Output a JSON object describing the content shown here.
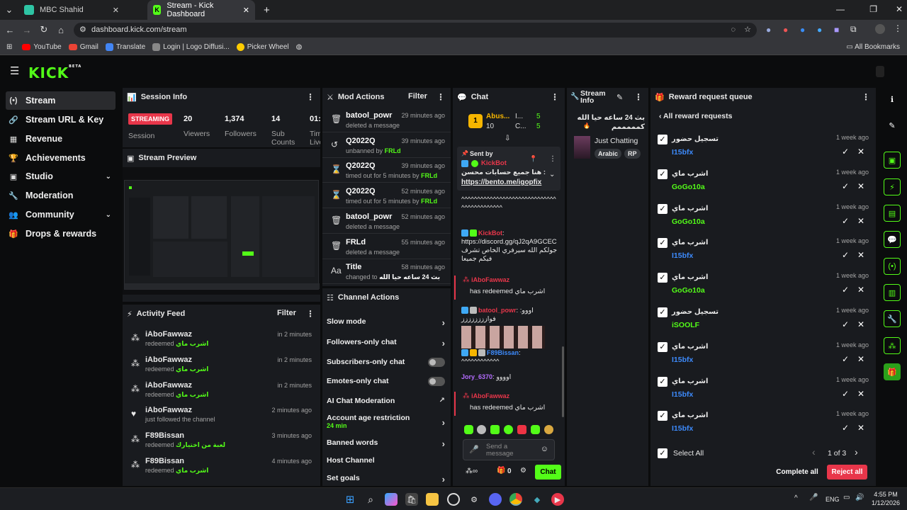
{
  "browser": {
    "tabs": [
      {
        "title": "MBC Shahid"
      },
      {
        "title": "Stream - Kick Dashboard"
      }
    ],
    "url": "dashboard.kick.com/stream",
    "bookmarks": [
      "YouTube",
      "Gmail",
      "Translate",
      "Login | Logo Diffusi...",
      "Picker Wheel"
    ],
    "all_bookmarks": "All Bookmarks"
  },
  "logo": {
    "text": "KICK",
    "tag": "BETA"
  },
  "sidebar": {
    "items": [
      {
        "label": "Stream"
      },
      {
        "label": "Stream URL & Key"
      },
      {
        "label": "Revenue"
      },
      {
        "label": "Achievements"
      },
      {
        "label": "Studio"
      },
      {
        "label": "Moderation"
      },
      {
        "label": "Community"
      },
      {
        "label": "Drops & rewards"
      }
    ]
  },
  "session": {
    "title": "Session Info",
    "status": "STREAMING",
    "session_label": "Session",
    "stats": [
      {
        "value": "20",
        "label": "Viewers"
      },
      {
        "value": "1,374",
        "label": "Followers"
      },
      {
        "value": "14",
        "label": "Sub Counts"
      },
      {
        "value": "01:",
        "label": "Tim Live"
      }
    ]
  },
  "preview": {
    "title": "Stream Preview"
  },
  "activity": {
    "title": "Activity Feed",
    "filter": "Filter",
    "items": [
      {
        "user": "iAboFawwaz",
        "action": "redeemed",
        "reward": "اشرب ماي",
        "time": "in 2 minutes"
      },
      {
        "user": "iAboFawwaz",
        "action": "redeemed",
        "reward": "اشرب ماي",
        "time": "in 2 minutes"
      },
      {
        "user": "iAboFawwaz",
        "action": "redeemed",
        "reward": "اشرب ماي",
        "time": "in 2 minutes"
      },
      {
        "user": "iAboFawwaz",
        "action": "just followed the channel",
        "reward": "",
        "time": "2 minutes ago"
      },
      {
        "user": "F89Bissan",
        "action": "redeemed",
        "reward": "لعبة من اختيارك",
        "time": "3 minutes ago"
      },
      {
        "user": "F89Bissan",
        "action": "redeemed",
        "reward": "اشرب ماي",
        "time": "4 minutes ago"
      }
    ]
  },
  "mod": {
    "title": "Mod Actions",
    "filter": "Filter",
    "items": [
      {
        "target": "batool_powr",
        "action": "deleted a message",
        "by": "",
        "time": "29 minutes ago",
        "icon": "trash-icon"
      },
      {
        "target": "Q2022Q",
        "action": "unbanned by",
        "by": "FRLd",
        "time": "39 minutes ago",
        "icon": "undo-icon"
      },
      {
        "target": "Q2022Q",
        "action": "timed out for 5 minutes by",
        "by": "FRLd",
        "time": "39 minutes ago",
        "icon": "hourglass-icon"
      },
      {
        "target": "Q2022Q",
        "action": "timed out for 5 minutes by",
        "by": "FRLd",
        "time": "52 minutes ago",
        "icon": "hourglass-icon"
      },
      {
        "target": "batool_powr",
        "action": "deleted a message",
        "by": "",
        "time": "52 minutes ago",
        "icon": "trash-icon"
      },
      {
        "target": "FRLd",
        "action": "deleted a message",
        "by": "",
        "time": "55 minutes ago",
        "icon": "trash-icon"
      },
      {
        "target": "Title",
        "action": "changed to",
        "by": "بث 24 ساعه حيا الله",
        "time": "58 minutes ago",
        "icon": "title-icon"
      }
    ]
  },
  "channel_actions": {
    "title": "Channel Actions",
    "items": [
      {
        "label": "Slow mode",
        "control": "arrow",
        "sub": ""
      },
      {
        "label": "Followers-only chat",
        "control": "arrow",
        "sub": ""
      },
      {
        "label": "Subscribers-only chat",
        "control": "toggle",
        "sub": ""
      },
      {
        "label": "Emotes-only chat",
        "control": "toggle",
        "sub": ""
      },
      {
        "label": "AI Chat Moderation",
        "control": "external",
        "sub": ""
      },
      {
        "label": "Account age restriction",
        "control": "arrow",
        "sub": "24 min"
      },
      {
        "label": "Banned words",
        "control": "arrow",
        "sub": ""
      },
      {
        "label": "Host Channel",
        "control": "none",
        "sub": ""
      },
      {
        "label": "Set goals",
        "control": "arrow",
        "sub": ""
      }
    ]
  },
  "chat": {
    "title": "Chat",
    "leaderboard": [
      {
        "name": "Abus...",
        "count": "10"
      },
      {
        "name": "I...",
        "count": "5"
      },
      {
        "name": "C...",
        "count": "5"
      }
    ],
    "pinned": {
      "sent_by": "Sent by",
      "user": "KickBot",
      "text": "هنا جميع حسابات محسن :",
      "link": "https://bento.me/igopfix"
    },
    "messages": [
      {
        "user": "",
        "text": "^^^^^^^^^^^^^^^^^^^^^^^^^^^^^^^^^^^^^^^^^^^"
      },
      {
        "user": "KickBot",
        "text": "https://discord.gg/qJ2qA9GCEC جولكم الله سيرفري الخاص تشرف فيكم جميعا"
      },
      {
        "user": "iAboFawwaz",
        "text": "has redeemed اشرب ماي"
      },
      {
        "user": "batool_powr",
        "text": "اووو: فوازززززززز"
      },
      {
        "user": "F89Bissan",
        "text": "^^^^^^^^^^^^"
      },
      {
        "user": "Jory_6370",
        "text": "اوووو"
      },
      {
        "user": "iAboFawwaz",
        "text": "has redeemed اشرب ماي"
      }
    ],
    "placeholder": "Send a message",
    "points": "0",
    "send": "Chat"
  },
  "stream_info": {
    "title": "Stream Info",
    "stream_title": "بث 24 ساعه حيا الله كمممممم",
    "category": "Just Chatting",
    "tags": [
      "Arabic",
      "RP"
    ]
  },
  "rewards": {
    "title": "Reward request queue",
    "back": "All reward requests",
    "items": [
      {
        "title": "تسجيل حضور",
        "user": "I15bfx",
        "color": "#3d8bfd",
        "time": "1 week ago"
      },
      {
        "title": "اشرب ماي",
        "user": "GoGo10a",
        "color": "#53fc18",
        "time": "1 week ago"
      },
      {
        "title": "اشرب ماي",
        "user": "GoGo10a",
        "color": "#53fc18",
        "time": "1 week ago"
      },
      {
        "title": "اشرب ماي",
        "user": "I15bfx",
        "color": "#3d8bfd",
        "time": "1 week ago"
      },
      {
        "title": "اشرب ماي",
        "user": "GoGo10a",
        "color": "#53fc18",
        "time": "1 week ago"
      },
      {
        "title": "تسجيل حضور",
        "user": "iSOOLF",
        "color": "#53fc18",
        "time": "1 week ago"
      },
      {
        "title": "اشرب ماي",
        "user": "I15bfx",
        "color": "#3d8bfd",
        "time": "1 week ago"
      },
      {
        "title": "اشرب ماي",
        "user": "I15bfx",
        "color": "#3d8bfd",
        "time": "1 week ago"
      },
      {
        "title": "اشرب ماي",
        "user": "I15bfx",
        "color": "#3d8bfd",
        "time": "1 week ago"
      }
    ],
    "select_all": "Select All",
    "page": "1 of 3",
    "complete_all": "Complete all",
    "reject_all": "Reject all"
  },
  "taskbar": {
    "lang": "ENG",
    "time": "4:55 PM",
    "date": "1/12/2026"
  },
  "colors": {
    "accent": "#53fc18",
    "panel": "#191b1f",
    "danger": "#e8364a"
  }
}
